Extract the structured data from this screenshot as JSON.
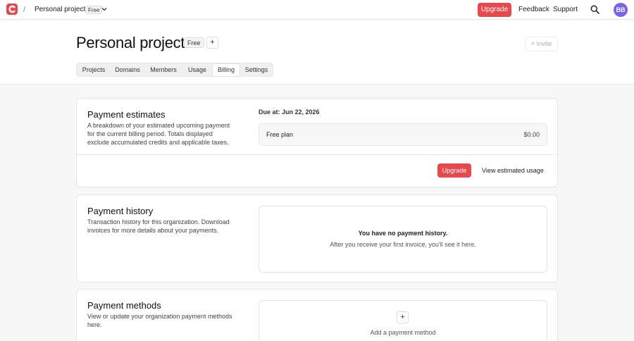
{
  "topbar": {
    "separator": "/",
    "project_name": "Personal projects",
    "plan_badge": "Free",
    "upgrade_label": "Upgrade",
    "feedback_label": "Feedback",
    "support_label": "Support",
    "avatar_initials": "BB"
  },
  "header": {
    "title": "Personal projects",
    "plan_badge": "Free",
    "add_symbol": "+",
    "invite_label": "Invite",
    "tabs": [
      {
        "label": "Projects"
      },
      {
        "label": "Domains"
      },
      {
        "label": "Members"
      },
      {
        "label": "Usage"
      },
      {
        "label": "Billing"
      },
      {
        "label": "Settings"
      }
    ]
  },
  "estimates": {
    "title": "Payment estimates",
    "description": "A breakdown of your estimated upcoming payment for the current billing period. Totals displayed exclude accumulated credits and applicable taxes.",
    "due_text": "Due at: Jun 22, 2026",
    "plan_name": "Free plan",
    "plan_price": "$0.00",
    "upgrade_label": "Upgrade",
    "usage_label": "View estimated usage"
  },
  "history": {
    "title": "Payment history",
    "description": "Transaction history for this organization. Download invoices for more details about your payments.",
    "empty_title": "You have no payment history.",
    "empty_sub": "After you receive your first invoice, you'll see it here."
  },
  "methods": {
    "title": "Payment methods",
    "description": "View or update your organization payment methods here.",
    "add_symbol": "+",
    "add_label": "Add a payment method"
  },
  "colors": {
    "accent": "#e5484d",
    "avatar": "#7b61e8"
  },
  "icons": [
    "logo-icon",
    "chevron-down-icon",
    "search-icon",
    "plus-icon"
  ]
}
